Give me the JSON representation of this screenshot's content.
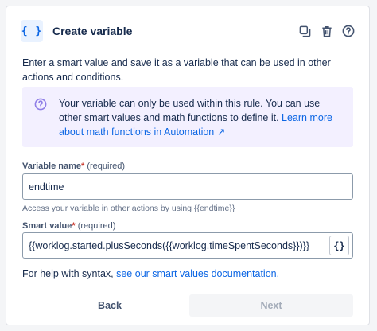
{
  "header": {
    "icon": "curly-braces-icon",
    "icon_glyph": "{ }",
    "title": "Create variable",
    "actions": [
      "duplicate-icon",
      "trash-icon",
      "help-icon"
    ]
  },
  "description": "Enter a smart value and save it as a variable that can be used in other actions and conditions.",
  "info": {
    "icon": "question-circle-icon",
    "text": "Your variable can only be used within this rule. You can use other smart values and math functions to define it. ",
    "link_text": "Learn more about math functions in Automation",
    "link_arrow": "↗"
  },
  "variable_name": {
    "label": "Variable name",
    "required_star": "*",
    "required_text": "(required)",
    "value": "endtime",
    "helper": "Access your variable in other actions by using {{endtime}}"
  },
  "smart_value": {
    "label": "Smart value",
    "required_star": "*",
    "required_text": "(required)",
    "value": "{{worklog.started.plusSeconds({{worklog.timeSpentSeconds}})}}",
    "button_glyph": "{}"
  },
  "syntax_help": {
    "text": "For help with syntax, ",
    "link_text": "see our smart values documentation."
  },
  "footer": {
    "back_label": "Back",
    "next_label": "Next"
  },
  "colors": {
    "accent": "#0c66e4",
    "info_bg": "#f3f0ff",
    "info_icon": "#8f7ee7"
  }
}
